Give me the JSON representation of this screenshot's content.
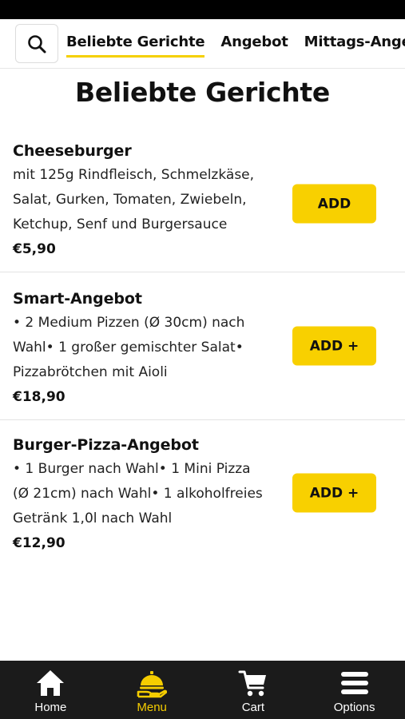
{
  "header": {
    "tabs": [
      {
        "label": "Beliebte Gerichte",
        "active": true
      },
      {
        "label": "Angebot",
        "active": false
      },
      {
        "label": "Mittags-Angebot",
        "active": false
      }
    ]
  },
  "section": {
    "title": "Beliebte Gerichte"
  },
  "items": [
    {
      "name": "Cheeseburger",
      "description": "mit 125g Rindfleisch, Schmelzkäse, Salat, Gurken, Tomaten, Zwiebeln, Ketchup, Senf und Burgersauce",
      "price": "€5,90",
      "button_label": "ADD"
    },
    {
      "name": "Smart-Angebot",
      "description": "• 2 Medium Pizzen (Ø 30cm) nach Wahl• 1 großer gemischter Salat• Pizzabrötchen mit Aioli",
      "price": "€18,90",
      "button_label": "ADD +"
    },
    {
      "name": "Burger-Pizza-Angebot",
      "description": "• 1 Burger nach Wahl• 1 Mini Pizza (Ø 21cm) nach Wahl• 1 alkoholfreies Getränk 1,0l nach Wahl",
      "price": "€12,90",
      "button_label": "ADD +"
    }
  ],
  "bottom_nav": {
    "items": [
      {
        "label": "Home",
        "icon": "home-icon",
        "active": false
      },
      {
        "label": "Menu",
        "icon": "menu-icon",
        "active": true
      },
      {
        "label": "Cart",
        "icon": "cart-icon",
        "active": false
      },
      {
        "label": "Options",
        "icon": "options-icon",
        "active": false
      }
    ]
  },
  "colors": {
    "accent": "#f8d000",
    "nav_background": "#1b1b1b",
    "active_nav": "#f5cd00"
  }
}
